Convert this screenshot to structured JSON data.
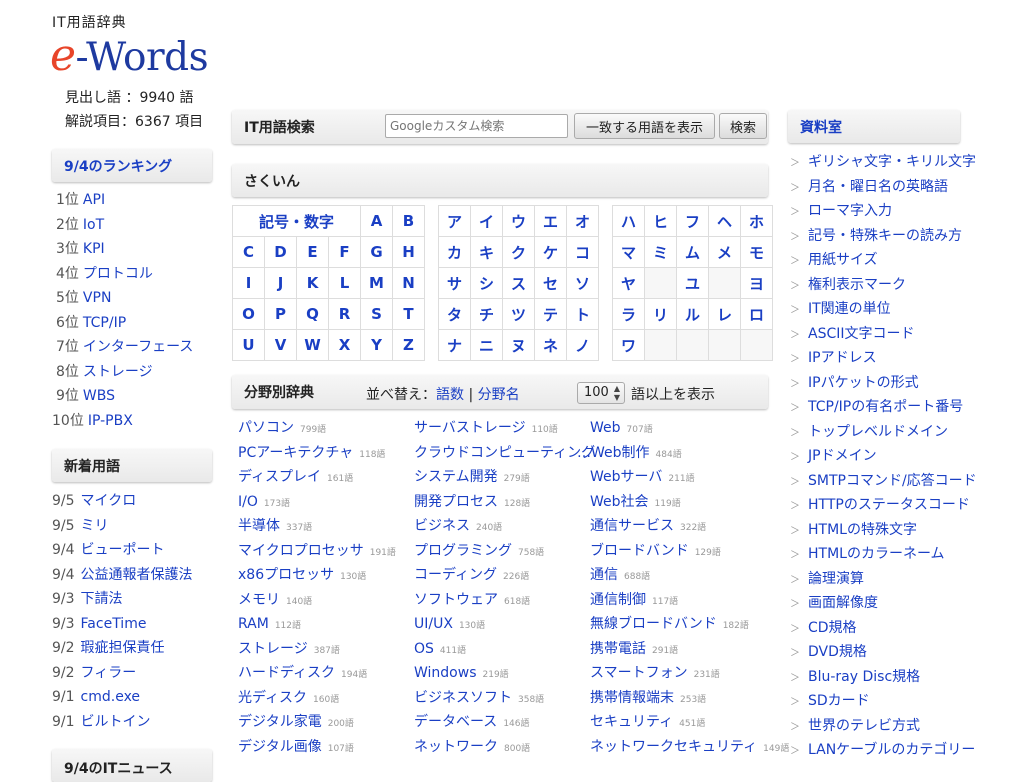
{
  "logo": {
    "sub": "IT用語辞典",
    "e": "e",
    "rest": "-Words"
  },
  "stats": {
    "headwords": "見出し語 ：9940 語",
    "entries": "解説項目：6367 項目"
  },
  "ranking": {
    "title": "9/4のランキング",
    "items": [
      {
        "rank": "1位",
        "label": "API"
      },
      {
        "rank": "2位",
        "label": "IoT"
      },
      {
        "rank": "3位",
        "label": "KPI"
      },
      {
        "rank": "4位",
        "label": "プロトコル"
      },
      {
        "rank": "5位",
        "label": "VPN"
      },
      {
        "rank": "6位",
        "label": "TCP/IP"
      },
      {
        "rank": "7位",
        "label": "インターフェース"
      },
      {
        "rank": "8位",
        "label": "ストレージ"
      },
      {
        "rank": "9位",
        "label": "WBS"
      },
      {
        "rank": "10位",
        "label": "IP-PBX"
      }
    ]
  },
  "newterms": {
    "title": "新着用語",
    "items": [
      {
        "date": "9/5",
        "label": "マイクロ"
      },
      {
        "date": "9/5",
        "label": "ミリ"
      },
      {
        "date": "9/4",
        "label": "ビューポート"
      },
      {
        "date": "9/4",
        "label": "公益通報者保護法"
      },
      {
        "date": "9/3",
        "label": "下請法"
      },
      {
        "date": "9/3",
        "label": "FaceTime"
      },
      {
        "date": "9/2",
        "label": "瑕疵担保責任"
      },
      {
        "date": "9/2",
        "label": "フィラー"
      },
      {
        "date": "9/1",
        "label": "cmd.exe"
      },
      {
        "date": "9/1",
        "label": "ビルトイン"
      }
    ]
  },
  "news": {
    "title": "9/4のITニュース"
  },
  "search": {
    "title": "IT用語検索",
    "placeholder": "Googleカスタム検索",
    "match_button": "一致する用語を表示",
    "search_button": "検索"
  },
  "sakuin": {
    "title": "さくいん",
    "kigou": "記号・数字",
    "alpha": [
      [
        "A",
        "B"
      ],
      [
        "C",
        "D",
        "E",
        "F",
        "G",
        "H"
      ],
      [
        "I",
        "J",
        "K",
        "L",
        "M",
        "N"
      ],
      [
        "O",
        "P",
        "Q",
        "R",
        "S",
        "T"
      ],
      [
        "U",
        "V",
        "W",
        "X",
        "Y",
        "Z"
      ]
    ],
    "kana1": [
      [
        "ア",
        "イ",
        "ウ",
        "エ",
        "オ"
      ],
      [
        "カ",
        "キ",
        "ク",
        "ケ",
        "コ"
      ],
      [
        "サ",
        "シ",
        "ス",
        "セ",
        "ソ"
      ],
      [
        "タ",
        "チ",
        "ツ",
        "テ",
        "ト"
      ],
      [
        "ナ",
        "ニ",
        "ヌ",
        "ネ",
        "ノ"
      ]
    ],
    "kana2": [
      [
        "ハ",
        "ヒ",
        "フ",
        "ヘ",
        "ホ"
      ],
      [
        "マ",
        "ミ",
        "ム",
        "メ",
        "モ"
      ],
      [
        "ヤ",
        "",
        "ユ",
        "",
        "ヨ"
      ],
      [
        "ラ",
        "リ",
        "ル",
        "レ",
        "ロ"
      ],
      [
        "ワ",
        "",
        "",
        "",
        ""
      ]
    ]
  },
  "categories": {
    "title": "分野別辞典",
    "sort_prefix": "並べ替え：",
    "sort_count": "語数",
    "sort_sep": " | ",
    "sort_name": "分野名",
    "min_value": "100",
    "show_suffix": "語以上を表示",
    "col1": [
      {
        "name": "パソコン",
        "count": "799語"
      },
      {
        "name": "PCアーキテクチャ",
        "count": "118語"
      },
      {
        "name": "ディスプレイ",
        "count": "161語"
      },
      {
        "name": "I/O",
        "count": "173語"
      },
      {
        "name": "半導体",
        "count": "337語"
      },
      {
        "name": "マイクロプロセッサ",
        "count": "191語"
      },
      {
        "name": "x86プロセッサ",
        "count": "130語"
      },
      {
        "name": "メモリ",
        "count": "140語"
      },
      {
        "name": "RAM",
        "count": "112語"
      },
      {
        "name": "ストレージ",
        "count": "387語"
      },
      {
        "name": "ハードディスク",
        "count": "194語"
      },
      {
        "name": "光ディスク",
        "count": "160語"
      },
      {
        "name": "デジタル家電",
        "count": "200語"
      },
      {
        "name": "デジタル画像",
        "count": "107語"
      }
    ],
    "col2": [
      {
        "name": "サーバストレージ",
        "count": "110語"
      },
      {
        "name": "クラウドコンピューティング",
        "count": ""
      },
      {
        "name": "システム開発",
        "count": "279語"
      },
      {
        "name": "開発プロセス",
        "count": "128語"
      },
      {
        "name": "ビジネス",
        "count": "240語"
      },
      {
        "name": "プログラミング",
        "count": "758語"
      },
      {
        "name": "コーディング",
        "count": "226語"
      },
      {
        "name": "ソフトウェア",
        "count": "618語"
      },
      {
        "name": "UI/UX",
        "count": "130語"
      },
      {
        "name": "OS",
        "count": "411語"
      },
      {
        "name": "Windows",
        "count": "219語"
      },
      {
        "name": "ビジネスソフト",
        "count": "358語"
      },
      {
        "name": "データベース",
        "count": "146語"
      },
      {
        "name": "ネットワーク",
        "count": "800語"
      }
    ],
    "col3": [
      {
        "name": "Web",
        "count": "707語"
      },
      {
        "name": "…Web制作",
        "count": "484語"
      },
      {
        "name": "Webサーバ",
        "count": "211語"
      },
      {
        "name": "Web社会",
        "count": "119語"
      },
      {
        "name": "通信サービス",
        "count": "322語"
      },
      {
        "name": "ブロードバンド",
        "count": "129語"
      },
      {
        "name": "通信",
        "count": "688語"
      },
      {
        "name": "通信制御",
        "count": "117語"
      },
      {
        "name": "無線ブロードバンド",
        "count": "182語"
      },
      {
        "name": "携帯電話",
        "count": "291語"
      },
      {
        "name": "スマートフォン",
        "count": "231語"
      },
      {
        "name": "携帯情報端末",
        "count": "253語"
      },
      {
        "name": "セキュリティ",
        "count": "451語"
      },
      {
        "name": "ネットワークセキュリティ",
        "count": "149語"
      }
    ]
  },
  "reference": {
    "title": "資料室",
    "bullet": "＞",
    "items": [
      "ギリシャ文字・キリル文字",
      "月名・曜日名の英略語",
      "ローマ字入力",
      "記号・特殊キーの読み方",
      "用紙サイズ",
      "権利表示マーク",
      "IT関連の単位",
      "ASCII文字コード",
      "IPアドレス",
      "IPパケットの形式",
      "TCP/IPの有名ポート番号",
      "トップレベルドメイン",
      "JPドメイン",
      "SMTPコマンド/応答コード",
      "HTTPのステータスコード",
      "HTMLの特殊文字",
      "HTMLのカラーネーム",
      "論理演算",
      "画面解像度",
      "CD規格",
      "DVD規格",
      "Blu-ray Disc規格",
      "SDカード",
      "世界のテレビ方式",
      "LANケーブルのカテゴリー"
    ]
  }
}
